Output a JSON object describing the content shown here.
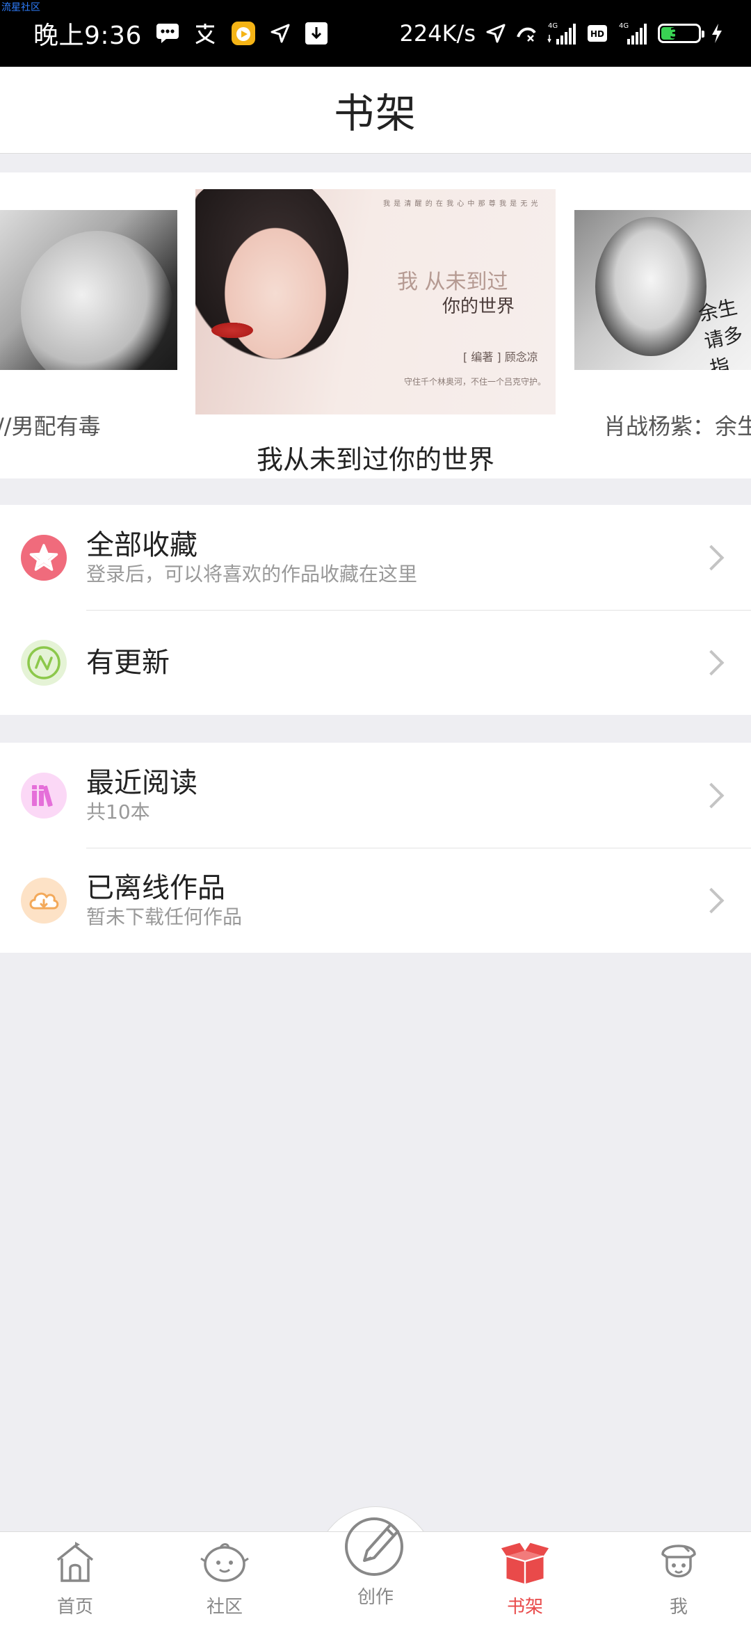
{
  "watermark": "流星社区",
  "status_bar": {
    "time": "晚上9:36",
    "speed": "224K/s",
    "net1": "4G",
    "net2": "4G",
    "hd": "HD",
    "battery": "35",
    "battery_level": 0.35
  },
  "header": {
    "title": "书架"
  },
  "carousel": {
    "left_title": "//男配有毒",
    "center_title": "我从未到过你的世界",
    "right_title": "肖战杨紫：余生",
    "center_cover": {
      "line1": "我  从未到过",
      "line2": "你的世界",
      "author": "[ 编著 ] 顾念凉",
      "top_text": "我 是 清 醒 的 在 我 心 中 那 尊 我 是 无 光",
      "bottom_text": "守住千个林奥河，不住一个吕克守护。"
    },
    "right_cover": {
      "text": "余生请多指"
    }
  },
  "menu_group_1": [
    {
      "label": "全部收藏",
      "sub": "登录后，可以将喜欢的作品收藏在这里",
      "icon": "star-icon",
      "icon_color": "#f06b7c",
      "icon_bg": "#fce4e7"
    },
    {
      "label": "有更新",
      "sub": "",
      "icon": "update-icon",
      "icon_color": "#8cc84b",
      "icon_bg": "#e5f3d6"
    }
  ],
  "menu_group_2": [
    {
      "label": "最近阅读",
      "sub": "共10本",
      "icon": "books-icon",
      "icon_color": "#e56fd9",
      "icon_bg": "#fbd8f6"
    },
    {
      "label": "已离线作品",
      "sub": "暂未下载任何作品",
      "icon": "cloud-download-icon",
      "icon_color": "#f3a95a",
      "icon_bg": "#fde2c6"
    }
  ],
  "bottom_nav": {
    "home": "首页",
    "community": "社区",
    "create": "创作",
    "bookshelf": "书架",
    "me": "我",
    "active": "bookshelf",
    "active_color": "#e94a4a",
    "inactive_color": "#888888"
  }
}
